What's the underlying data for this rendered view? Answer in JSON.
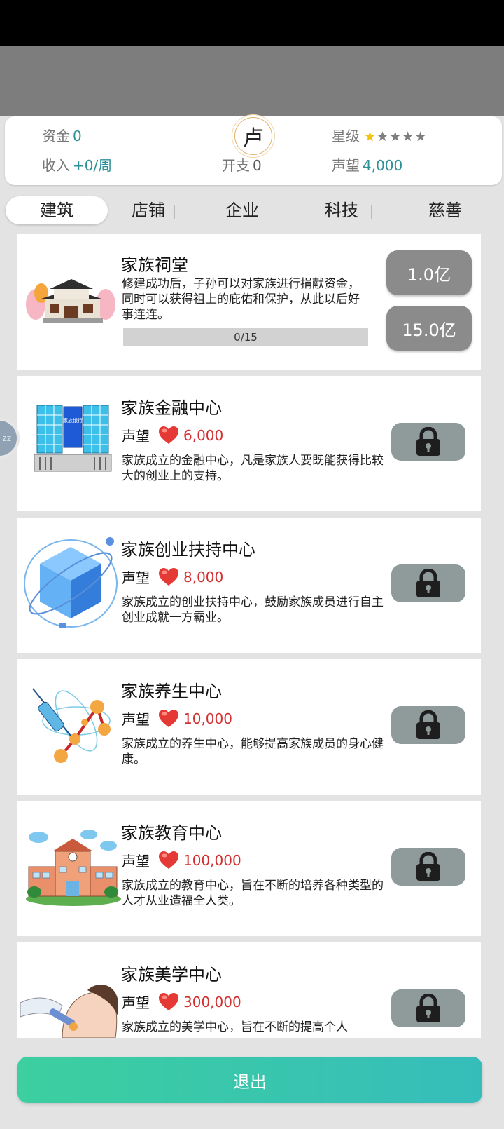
{
  "header": {
    "funds_label": "资金",
    "funds_value": "0",
    "income_label": "收入",
    "income_value": "+0/周",
    "family_char": "卢",
    "expense_label": "开支",
    "expense_value": "0",
    "stars_label": "星级",
    "stars_filled": 1,
    "stars_total": 5,
    "reputation_label": "声望",
    "reputation_value": "4,000"
  },
  "tabs": [
    {
      "label": "建筑",
      "active": true
    },
    {
      "label": "店铺",
      "active": false
    },
    {
      "label": "企业",
      "active": false
    },
    {
      "label": "科技",
      "active": false
    },
    {
      "label": "慈善",
      "active": false
    }
  ],
  "float_button": {
    "label": "zz"
  },
  "buildings": [
    {
      "title": "家族祠堂",
      "desc": "修建成功后，子孙可以对家族进行捐献资金，同时可以获得祖上的庇佑和保护，从此以后好事连连。",
      "progress_text": "0/15",
      "cost_primary": "1.0亿",
      "cost_secondary": "15.0亿"
    },
    {
      "title": "家族金融中心",
      "rep_label": "声望",
      "rep_value": "6,000",
      "desc": "家族成立的金融中心，凡是家族人要既能获得比较大的创业上的支持。",
      "thumb_text": "家族银行",
      "locked": true
    },
    {
      "title": "家族创业扶持中心",
      "rep_label": "声望",
      "rep_value": "8,000",
      "desc": "家族成立的创业扶持中心，鼓励家族成员进行自主创业成就一方霸业。",
      "locked": true
    },
    {
      "title": "家族养生中心",
      "rep_label": "声望",
      "rep_value": "10,000",
      "desc": "家族成立的养生中心，能够提高家族成员的身心健康。",
      "locked": true
    },
    {
      "title": "家族教育中心",
      "rep_label": "声望",
      "rep_value": "100,000",
      "desc": "家族成立的教育中心，旨在不断的培养各种类型的人才从业造福全人类。",
      "locked": true
    },
    {
      "title": "家族美学中心",
      "rep_label": "声望",
      "rep_value": "300,000",
      "desc": "家族成立的美学中心，旨在不断的提高个人",
      "locked": true
    }
  ],
  "exit_label": "退出",
  "colors": {
    "accent": "#2d8f97",
    "reputation": "#d32f2f",
    "exit_start": "#3dcf9f",
    "exit_end": "#35bdbb",
    "locked": "#8f9a9a"
  }
}
